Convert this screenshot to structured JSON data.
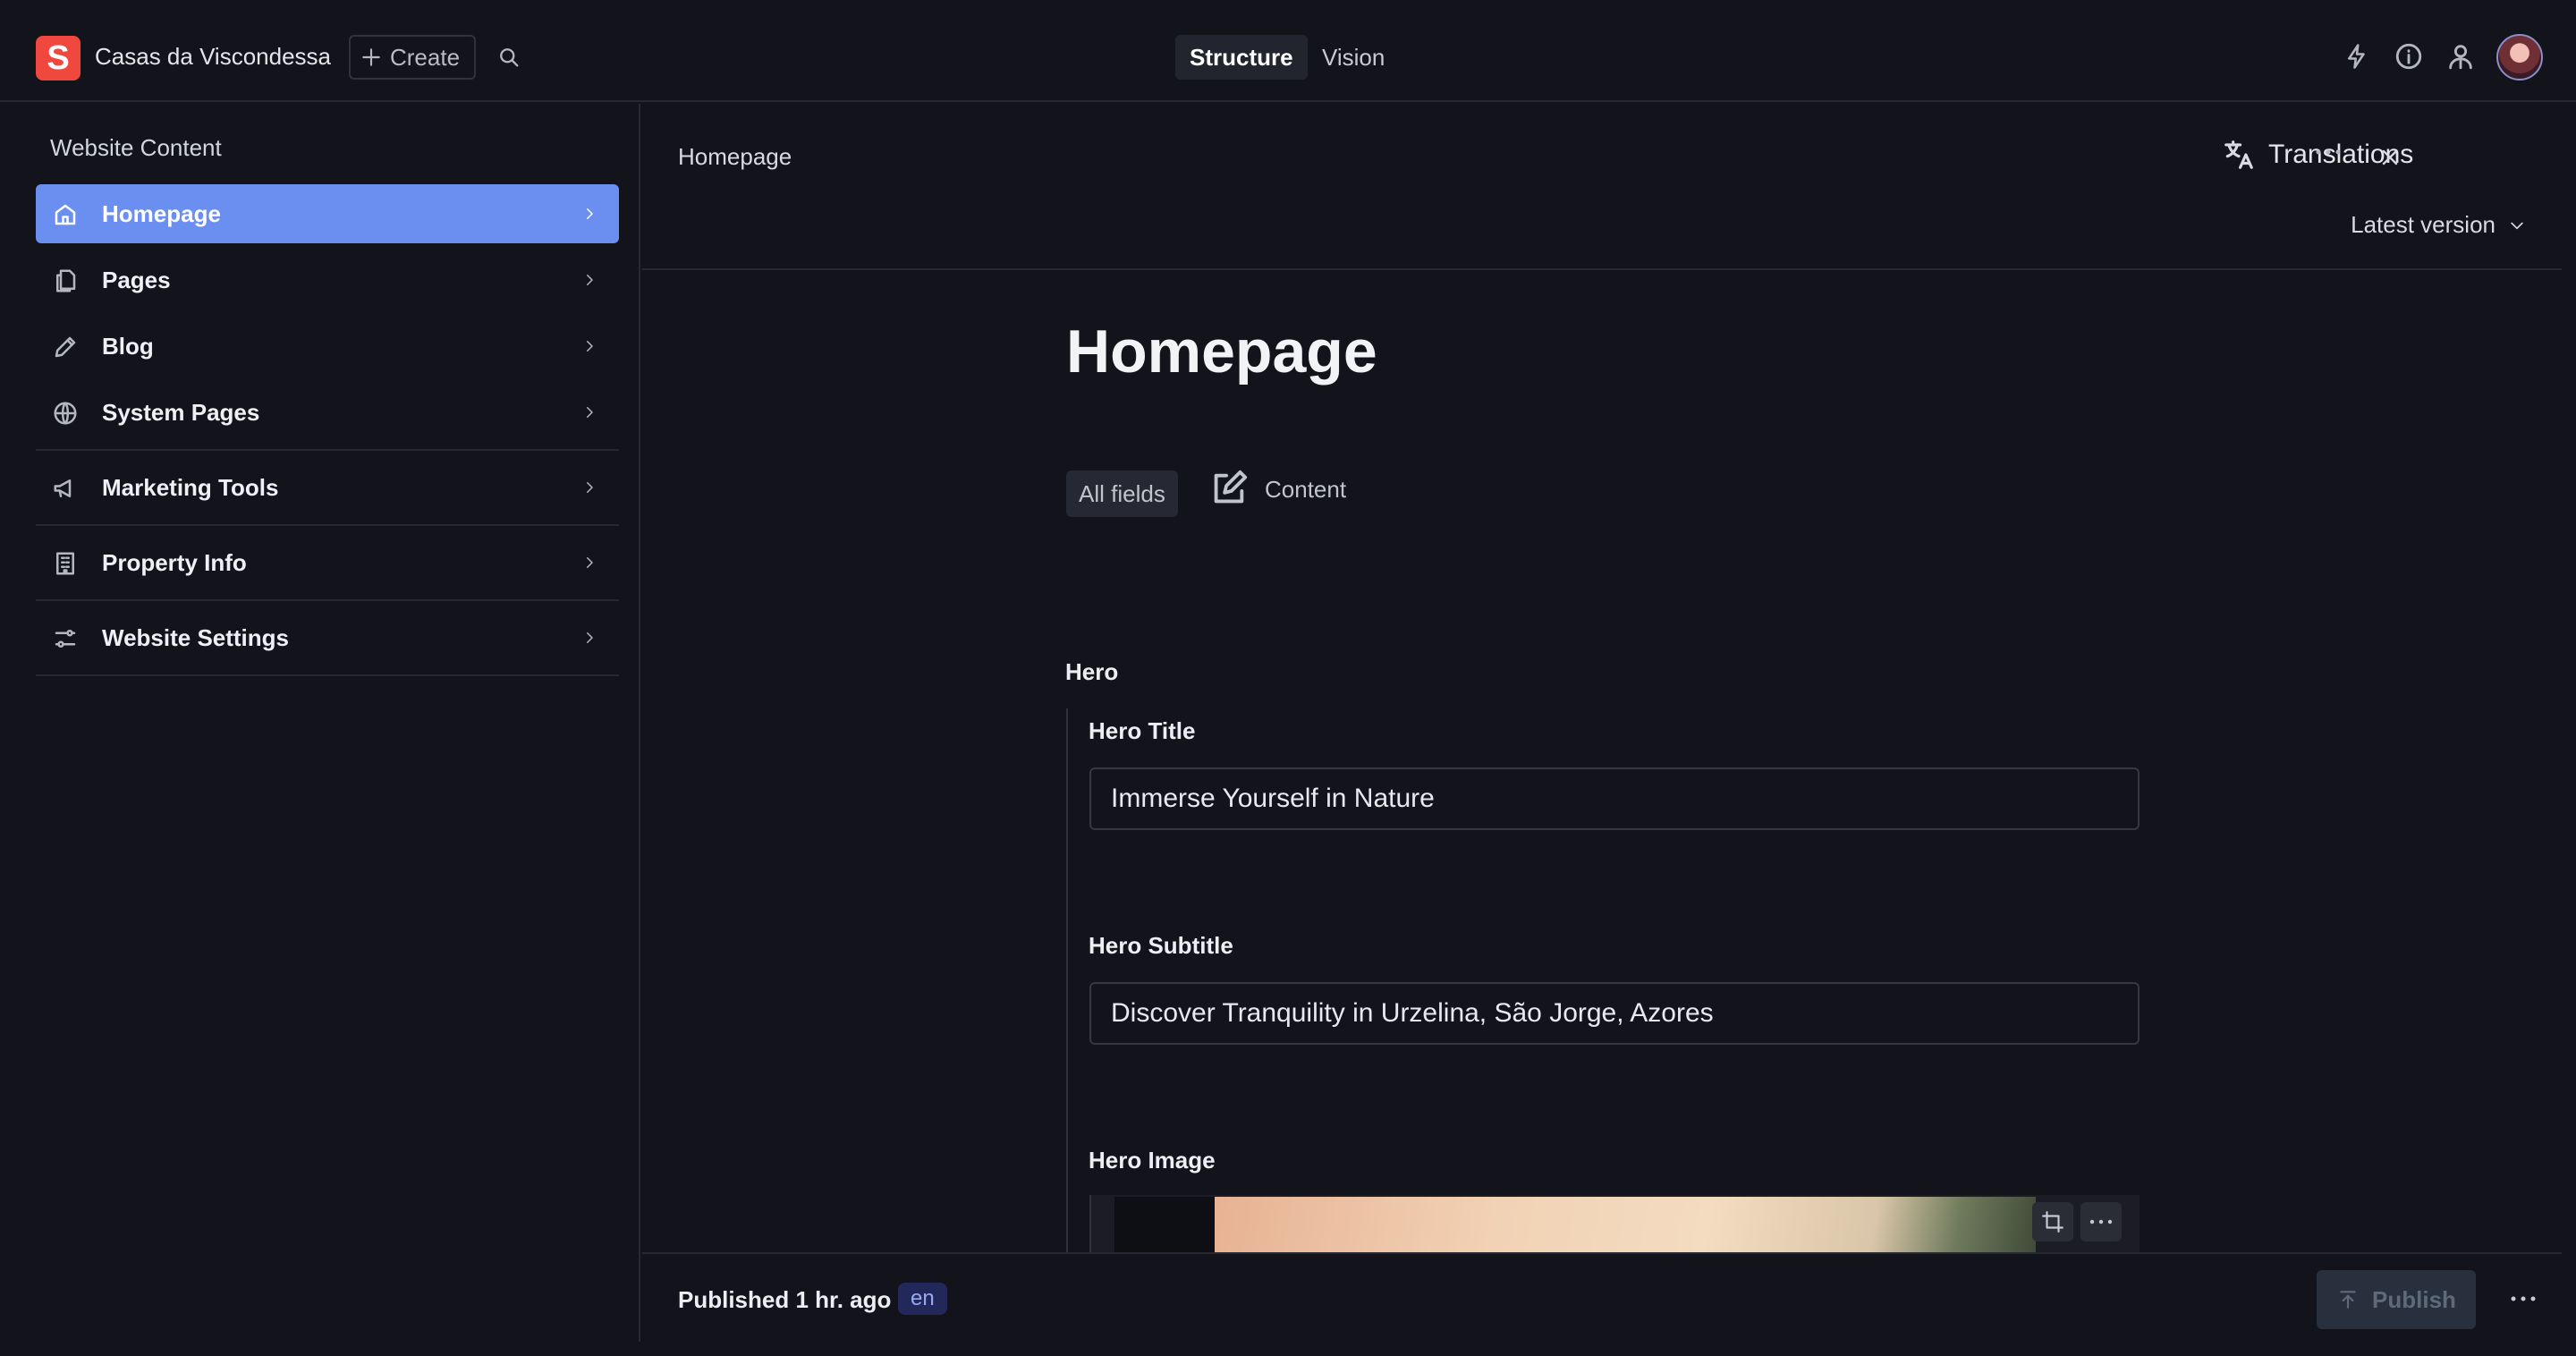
{
  "app": {
    "logo_letter": "S",
    "project_name": "Casas da Viscondessa",
    "create_label": "Create",
    "modes": [
      "Structure",
      "Vision"
    ]
  },
  "sidebar": {
    "title": "Website Content",
    "items": [
      {
        "label": "Homepage",
        "icon": "home-icon",
        "active": true
      },
      {
        "label": "Pages",
        "icon": "documents-icon"
      },
      {
        "label": "Blog",
        "icon": "pencil-icon"
      },
      {
        "label": "System Pages",
        "icon": "globe-icon"
      },
      {
        "label": "Marketing Tools",
        "icon": "megaphone-icon"
      },
      {
        "label": "Property Info",
        "icon": "building-icon"
      },
      {
        "label": "Website Settings",
        "icon": "sliders-icon"
      }
    ]
  },
  "document": {
    "breadcrumb": "Homepage",
    "translations_label": "Translations",
    "version_label": "Latest version",
    "title": "Homepage",
    "tabs": {
      "all": "All fields",
      "content": "Content"
    },
    "group": "Hero",
    "fields": {
      "hero_title_label": "Hero Title",
      "hero_title_value": "Immerse Yourself in Nature",
      "hero_subtitle_label": "Hero Subtitle",
      "hero_subtitle_value": "Discover Tranquility in Urzelina, São Jorge, Azores",
      "hero_image_label": "Hero Image"
    }
  },
  "footer": {
    "status": "Published 1 hr. ago",
    "language": "en",
    "publish_label": "Publish"
  },
  "colors": {
    "background": "#13141b",
    "accent_active": "#6a8ff0",
    "logo": "#f0473e"
  }
}
